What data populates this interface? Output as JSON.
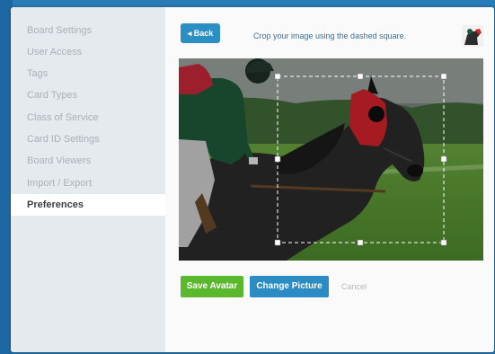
{
  "sidebar": {
    "items": [
      {
        "label": "Board Settings"
      },
      {
        "label": "User Access"
      },
      {
        "label": "Tags"
      },
      {
        "label": "Card Types"
      },
      {
        "label": "Class of Service"
      },
      {
        "label": "Card ID Settings"
      },
      {
        "label": "Board Viewers"
      },
      {
        "label": "Import / Export"
      },
      {
        "label": "Preferences",
        "active": true
      }
    ]
  },
  "toolbar": {
    "back_label": "◂ Back",
    "instruction": "Crop your image using the dashed square."
  },
  "actions": {
    "save_label": "Save Avatar",
    "change_label": "Change Picture",
    "cancel_label": "Cancel"
  },
  "icons": {
    "avatar_thumbnail": "horse-jockey-thumbnail",
    "crop_image": "horse-jockey-photo"
  },
  "colors": {
    "primary_blue": "#2a8cc2",
    "save_green": "#5ab82c",
    "sidebar_bg": "#e5eaee",
    "page_bg": "#1f6fa8"
  }
}
